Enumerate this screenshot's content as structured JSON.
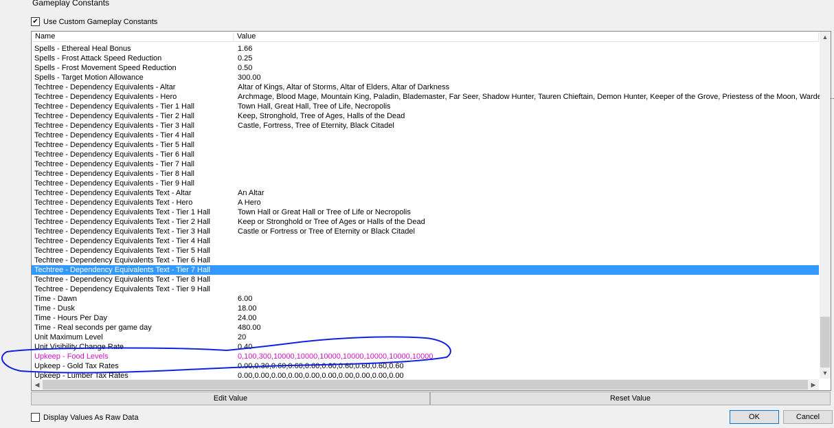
{
  "window": {
    "title": "Gameplay Constants"
  },
  "use_custom": {
    "label": "Use Custom Gameplay Constants",
    "checked": true
  },
  "columns": {
    "name": "Name",
    "value": "Value"
  },
  "rows": [
    {
      "name": "Spells - Ethereal Heal Bonus",
      "value": "1.66"
    },
    {
      "name": "Spells - Frost Attack Speed Reduction",
      "value": "0.25"
    },
    {
      "name": "Spells - Frost Movement Speed Reduction",
      "value": "0.50"
    },
    {
      "name": "Spells - Target Motion Allowance",
      "value": "300.00"
    },
    {
      "name": "Techtree - Dependency Equivalents - Altar",
      "value": "Altar of Kings, Altar of Storms, Altar of Elders, Altar of Darkness"
    },
    {
      "name": "Techtree - Dependency Equivalents - Hero",
      "value": "Archmage, Blood Mage, Mountain King, Paladin, Blademaster, Far Seer, Shadow Hunter, Tauren Chieftain, Demon Hunter, Keeper of the Grove, Priestess of the Moon, Warden, ..."
    },
    {
      "name": "Techtree - Dependency Equivalents - Tier 1 Hall",
      "value": "Town Hall, Great Hall, Tree of Life, Necropolis"
    },
    {
      "name": "Techtree - Dependency Equivalents - Tier 2 Hall",
      "value": "Keep, Stronghold, Tree of Ages, Halls of the Dead"
    },
    {
      "name": "Techtree - Dependency Equivalents - Tier 3 Hall",
      "value": "Castle, Fortress, Tree of Eternity, Black Citadel"
    },
    {
      "name": "Techtree - Dependency Equivalents - Tier 4 Hall",
      "value": ""
    },
    {
      "name": "Techtree - Dependency Equivalents - Tier 5 Hall",
      "value": ""
    },
    {
      "name": "Techtree - Dependency Equivalents - Tier 6 Hall",
      "value": ""
    },
    {
      "name": "Techtree - Dependency Equivalents - Tier 7 Hall",
      "value": ""
    },
    {
      "name": "Techtree - Dependency Equivalents - Tier 8 Hall",
      "value": ""
    },
    {
      "name": "Techtree - Dependency Equivalents - Tier 9 Hall",
      "value": ""
    },
    {
      "name": "Techtree - Dependency Equivalents Text - Altar",
      "value": "An Altar"
    },
    {
      "name": "Techtree - Dependency Equivalents Text - Hero",
      "value": "A Hero"
    },
    {
      "name": "Techtree - Dependency Equivalents Text - Tier 1 Hall",
      "value": "Town Hall or Great Hall or Tree of Life or Necropolis"
    },
    {
      "name": "Techtree - Dependency Equivalents Text - Tier 2 Hall",
      "value": "Keep or Stronghold or Tree of Ages or Halls of the Dead"
    },
    {
      "name": "Techtree - Dependency Equivalents Text - Tier 3 Hall",
      "value": "Castle or Fortress or Tree of Eternity or Black Citadel"
    },
    {
      "name": "Techtree - Dependency Equivalents Text - Tier 4 Hall",
      "value": ""
    },
    {
      "name": "Techtree - Dependency Equivalents Text - Tier 5 Hall",
      "value": ""
    },
    {
      "name": "Techtree - Dependency Equivalents Text - Tier 6 Hall",
      "value": ""
    },
    {
      "name": "Techtree - Dependency Equivalents Text - Tier 7 Hall",
      "value": "",
      "selected": true
    },
    {
      "name": "Techtree - Dependency Equivalents Text - Tier 8 Hall",
      "value": ""
    },
    {
      "name": "Techtree - Dependency Equivalents Text - Tier 9 Hall",
      "value": ""
    },
    {
      "name": "Time - Dawn",
      "value": "6.00"
    },
    {
      "name": "Time - Dusk",
      "value": "18.00"
    },
    {
      "name": "Time - Hours Per Day",
      "value": "24.00"
    },
    {
      "name": "Time - Real seconds per game day",
      "value": "480.00"
    },
    {
      "name": "Unit Maximum Level",
      "value": "20"
    },
    {
      "name": "Unit Visibility Change Rate",
      "value": "0.40"
    },
    {
      "name": "Upkeep - Food Levels",
      "value": "0,100,300,10000,10000,10000,10000,10000,10000,10000",
      "modified": true
    },
    {
      "name": "Upkeep - Gold Tax Rates",
      "value": "0.00,0.30,0.60,0.60,0.60,0.60,0.60,0.60,0.60,0.60"
    },
    {
      "name": "Upkeep - Lumber Tax Rates",
      "value": "0.00,0.00,0.00,0.00,0.00,0.00,0.00,0.00,0.00,0.00"
    }
  ],
  "buttons": {
    "edit": "Edit Value",
    "reset": "Reset Value",
    "ok": "OK",
    "cancel": "Cancel"
  },
  "raw": {
    "label": "Display Values As Raw Data",
    "checked": false
  },
  "colors": {
    "selection": "#3399ff",
    "modified": "#d010c0",
    "annotation": "#1020e0"
  }
}
